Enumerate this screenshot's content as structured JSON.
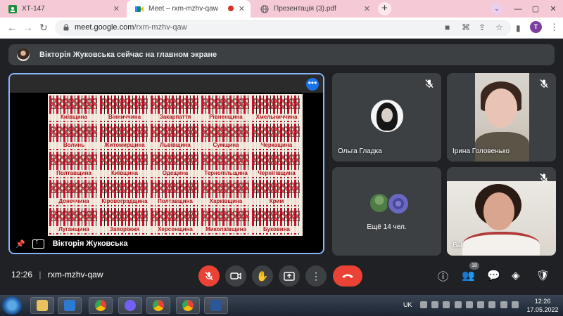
{
  "browser": {
    "tabs": [
      {
        "title": "ХТ-147"
      },
      {
        "title": "Meet – rxm-mzhv-qaw"
      },
      {
        "title": "Презентація (3).pdf"
      }
    ],
    "new_tab": "+",
    "url_host": "meet.google.com",
    "url_path": "/rxm-mzhv-qaw",
    "profile_initial": "T"
  },
  "meet": {
    "banner_text": "Вікторія Жуковська сейчас на главном экране",
    "presenter_name": "Вікторія Жуковська",
    "poster_regions": [
      "Київщина",
      "Вінниччина",
      "Закарпаття",
      "Рівненщина",
      "Хмельниччина",
      "Волинь",
      "Житомирщина",
      "Львівщина",
      "Сумщина",
      "Черкащина",
      "Полтавщина",
      "Київщина",
      "Одещина",
      "Тернопільщина",
      "Чернігівщина",
      "Донеччина",
      "Кіровоградщина",
      "Полтавщина",
      "Харківщина",
      "Крим",
      "Луганщина",
      "Запоріжжя",
      "Херсонщина",
      "Миколаївщина",
      "Буковина"
    ],
    "participants": [
      {
        "name": "Ольга Гладка"
      },
      {
        "name": "Ірина Головенько"
      },
      {
        "name": "Вы"
      }
    ],
    "more_count_label": "Ещё 14 чел.",
    "time": "12:26",
    "meeting_code": "rxm-mzhv-qaw",
    "participants_badge": "18"
  },
  "taskbar": {
    "lang": "UK",
    "clock_time": "12:26",
    "clock_date": "17.05.2022"
  },
  "colors": {
    "accent": "#8ab4f8",
    "danger": "#ea4335",
    "tile_bg": "#3c4043",
    "page_bg": "#202124"
  }
}
